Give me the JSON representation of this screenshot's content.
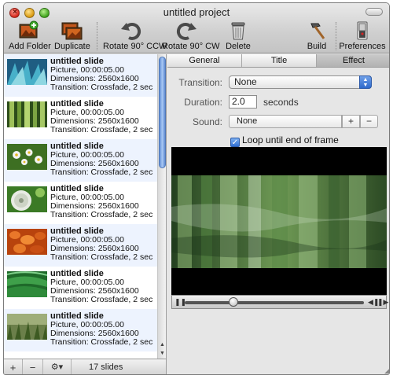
{
  "window": {
    "title": "untitled project"
  },
  "toolbar": {
    "add_folder": "Add Folder",
    "duplicate": "Duplicate",
    "rotate_ccw": "Rotate 90° CCW",
    "rotate_cw": "Rotate 90° CW",
    "delete": "Delete",
    "build": "Build",
    "preferences": "Preferences"
  },
  "slides": [
    {
      "title": "untitled slide",
      "line1": "Picture, 00:00:05.00",
      "line2": "Dimensions: 2560x1600",
      "line3": "Transition: Crossfade, 2 sec"
    },
    {
      "title": "untitled slide",
      "line1": "Picture, 00:00:05.00",
      "line2": "Dimensions: 2560x1600",
      "line3": "Transition: Crossfade, 2 sec"
    },
    {
      "title": "untitled slide",
      "line1": "Picture, 00:00:05.00",
      "line2": "Dimensions: 2560x1600",
      "line3": "Transition: Crossfade, 2 sec"
    },
    {
      "title": "untitled slide",
      "line1": "Picture, 00:00:05.00",
      "line2": "Dimensions: 2560x1600",
      "line3": "Transition: Crossfade, 2 sec"
    },
    {
      "title": "untitled slide",
      "line1": "Picture, 00:00:05.00",
      "line2": "Dimensions: 2560x1600",
      "line3": "Transition: Crossfade, 2 sec"
    },
    {
      "title": "untitled slide",
      "line1": "Picture, 00:00:05.00",
      "line2": "Dimensions: 2560x1600",
      "line3": "Transition: Crossfade, 2 sec"
    },
    {
      "title": "untitled slide",
      "line1": "Picture, 00:00:05.00",
      "line2": "Dimensions: 2560x1600",
      "line3": "Transition: Crossfade, 2 sec"
    }
  ],
  "footer": {
    "add": "+",
    "remove": "−",
    "gear": "⚙▾",
    "count": "17 slides"
  },
  "tabs": [
    "General",
    "Title",
    "Effect"
  ],
  "effect": {
    "transition_label": "Transition:",
    "transition_value": "None",
    "duration_label": "Duration:",
    "duration_value": "2.0",
    "duration_units": "seconds",
    "sound_label": "Sound:",
    "sound_value": "None",
    "sound_add": "+",
    "sound_remove": "−",
    "loop_label": "Loop until end of frame",
    "loop_checked": true
  },
  "player": {
    "progress": 0.27
  },
  "colors": {
    "selection_blue": "#2f6fd3",
    "alt_row": "#edf3fe"
  }
}
